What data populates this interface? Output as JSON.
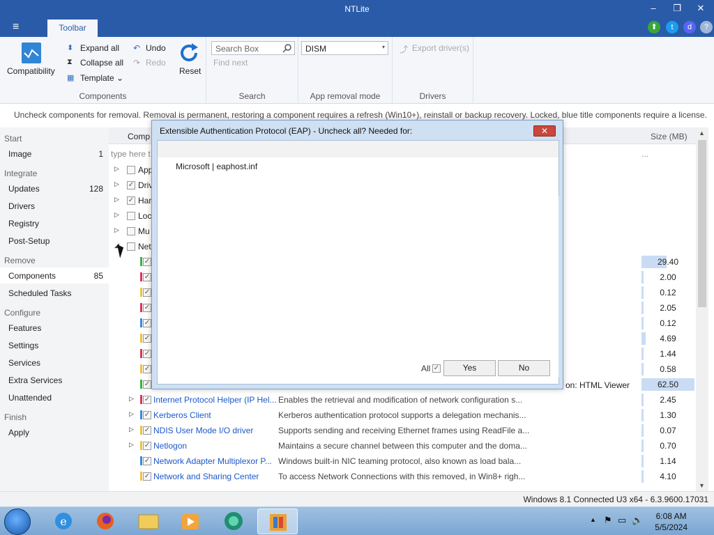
{
  "window": {
    "title": "NTLite",
    "min": "–",
    "restore": "❐",
    "close": "✕"
  },
  "tabs": {
    "menu_icon": "≡",
    "toolbar": "Toolbar"
  },
  "top_icons": [
    {
      "name": "update-arrow-icon",
      "glyph": "⬆",
      "color": "#3aa63a"
    },
    {
      "name": "twitter-icon",
      "glyph": "t",
      "color": "#1d9bf0"
    },
    {
      "name": "discord-icon",
      "glyph": "d",
      "color": "#5865f2"
    },
    {
      "name": "help-icon",
      "glyph": "?",
      "color": "#9fb6d8"
    }
  ],
  "ribbon": {
    "compatibility": "Compatibility",
    "expand_all": "Expand all",
    "collapse_all": "Collapse all",
    "template": "Template",
    "undo": "Undo",
    "redo": "Redo",
    "reset": "Reset",
    "components_label": "Components",
    "search_placeholder": "Search Box",
    "find_next": "Find next",
    "search_label": "Search",
    "removal_mode": "DISM",
    "app_removal_label": "App removal mode",
    "export_drivers": "Export driver(s)",
    "drivers_label": "Drivers"
  },
  "info_line": "Uncheck components for removal. Removal is permanent, restoring a component requires a refresh (Win10+), reinstall or backup recovery. Locked, blue title components require a license.",
  "sidebar": {
    "sections": [
      "Start",
      "Integrate",
      "Remove",
      "Configure",
      "Finish"
    ],
    "items": [
      {
        "label": "Image",
        "count": "1"
      },
      {
        "label": "Updates",
        "count": "128"
      },
      {
        "label": "Drivers",
        "count": ""
      },
      {
        "label": "Registry",
        "count": ""
      },
      {
        "label": "Post-Setup",
        "count": ""
      },
      {
        "label": "Components",
        "count": "85"
      },
      {
        "label": "Scheduled Tasks",
        "count": ""
      },
      {
        "label": "Features",
        "count": ""
      },
      {
        "label": "Settings",
        "count": ""
      },
      {
        "label": "Services",
        "count": ""
      },
      {
        "label": "Extra Services",
        "count": ""
      },
      {
        "label": "Unattended",
        "count": ""
      },
      {
        "label": "Apply",
        "count": ""
      }
    ]
  },
  "list": {
    "col_component": "Comp",
    "col_size": "Size (MB)",
    "filter_placeholder": "type here t",
    "filter_more": "...",
    "partial_desc": "on: HTML Viewer",
    "top_rows": [
      {
        "name": "App",
        "checked": false
      },
      {
        "name": "Driv",
        "checked": true
      },
      {
        "name": "Har",
        "checked": true
      },
      {
        "name": "Loc",
        "checked": false
      },
      {
        "name": "Mu",
        "checked": false
      },
      {
        "name": "Net",
        "checked": false
      }
    ],
    "sizes": [
      "29.40",
      "2.00",
      "0.12",
      "2.05",
      "0.12",
      "4.69",
      "1.44",
      "0.58",
      "62.50"
    ],
    "rows": [
      {
        "name": "Internet Protocol Helper (IP Hel...",
        "desc": "Enables the retrieval and modification of network configuration s...",
        "size": "2.45"
      },
      {
        "name": "Kerberos Client",
        "desc": "Kerberos authentication protocol supports a delegation mechanis...",
        "size": "1.30"
      },
      {
        "name": "NDIS User Mode I/O driver",
        "desc": "Supports sending and receiving Ethernet frames using ReadFile a...",
        "size": "0.07"
      },
      {
        "name": "Netlogon",
        "desc": "Maintains a secure channel between this computer and the doma...",
        "size": "0.70"
      },
      {
        "name": "Network Adapter Multiplexor P...",
        "desc": "Windows built-in NIC teaming protocol, also known as load bala...",
        "size": "1.14"
      },
      {
        "name": "Network and Sharing Center",
        "desc": "To access Network Connections with this removed, in Win8+ righ...",
        "size": "4.10"
      }
    ]
  },
  "status": "Windows 8.1 Connected U3 x64 - 6.3.9600.17031",
  "dialog": {
    "title": "Extensible Authentication Protocol (EAP) - Uncheck all? Needed for:",
    "close": "✕",
    "item": "Microsoft  |  eaphost.inf",
    "all_label": "All",
    "yes": "Yes",
    "no": "No"
  },
  "taskbar": {
    "time": "6:08 AM",
    "date": "5/5/2024"
  }
}
